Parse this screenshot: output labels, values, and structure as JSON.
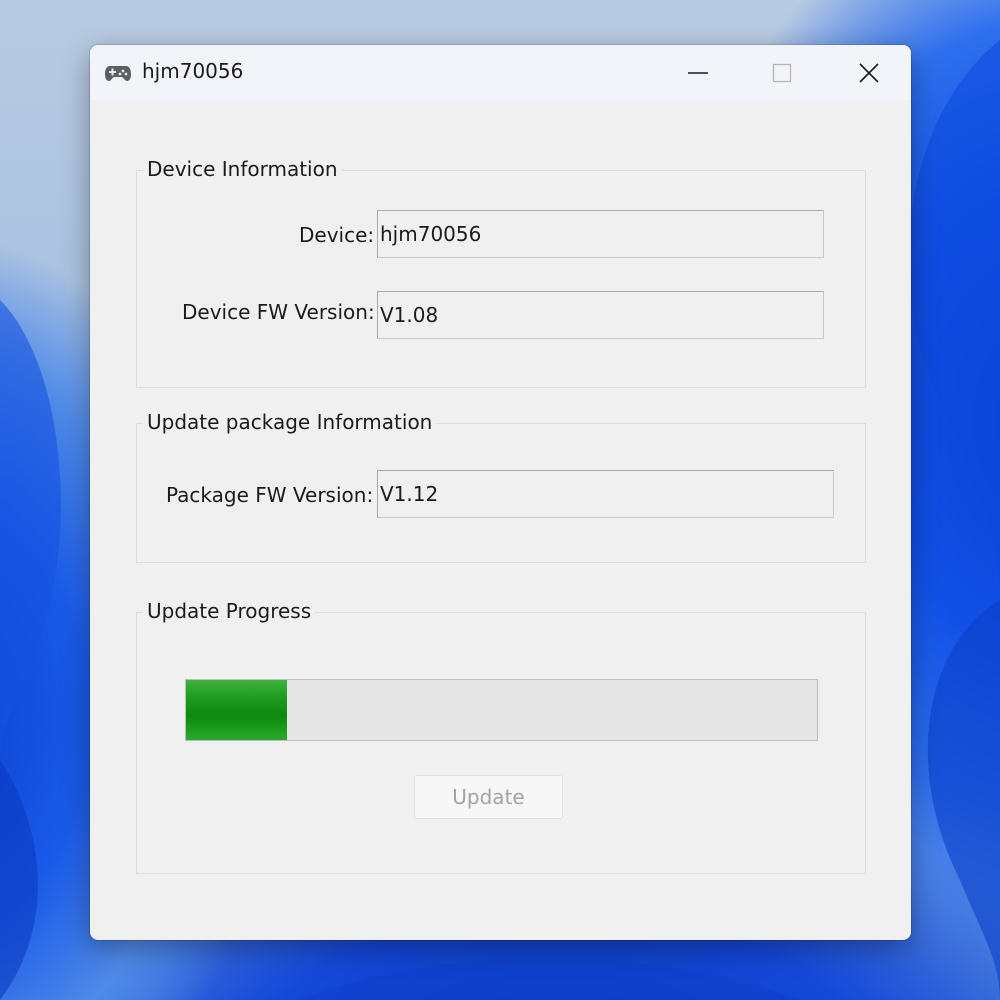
{
  "window": {
    "title": "hjm70056",
    "icons": {
      "app": "gamepad-icon",
      "minimize": "minimize-icon",
      "maximize": "maximize-icon",
      "close": "close-icon"
    }
  },
  "device_info": {
    "group_label": "Device Information",
    "device_label": "Device:",
    "device_value": "hjm70056",
    "fw_label": "Device FW Version:",
    "fw_value": "V1.08"
  },
  "package_info": {
    "group_label": "Update package Information",
    "fw_label": "Package FW Version:",
    "fw_value": "V1.12"
  },
  "progress": {
    "group_label": "Update Progress",
    "fraction": 0.16,
    "fill_color": "#1b961b",
    "button_label": "Update",
    "button_enabled": false
  }
}
